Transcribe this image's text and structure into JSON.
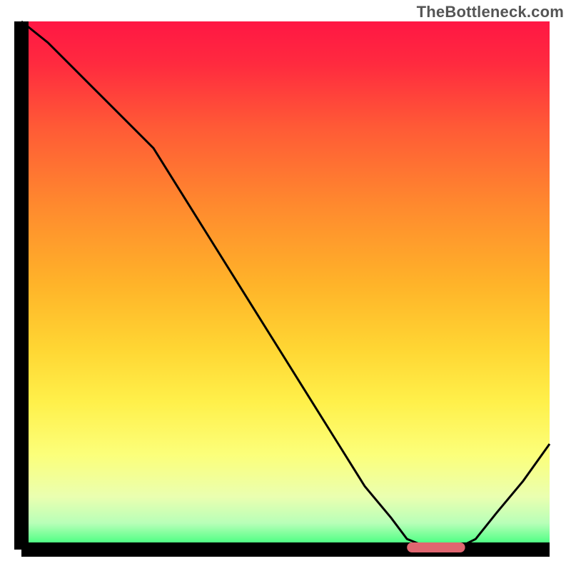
{
  "watermark": "TheBottleneck.com",
  "chart_data": {
    "type": "line",
    "title": "",
    "xlabel": "",
    "ylabel": "",
    "xlim": [
      0,
      100
    ],
    "ylim": [
      0,
      100
    ],
    "grid": false,
    "series": [
      {
        "name": "bottleneck-curve",
        "x": [
          0,
          5,
          10,
          15,
          20,
          25,
          30,
          35,
          40,
          45,
          50,
          55,
          60,
          65,
          70,
          73,
          78,
          82,
          86,
          90,
          95,
          100
        ],
        "values": [
          100,
          96,
          91,
          86,
          81,
          76,
          68,
          60,
          52,
          44,
          36,
          28,
          20,
          12,
          6,
          2,
          0,
          0,
          2,
          7,
          13,
          20
        ]
      }
    ],
    "marker": {
      "name": "target-range",
      "x_start": 73,
      "x_end": 84,
      "y": 0
    },
    "background_gradient_stops": [
      {
        "offset": 0.0,
        "color": "#ff1744"
      },
      {
        "offset": 0.08,
        "color": "#ff2a3f"
      },
      {
        "offset": 0.2,
        "color": "#ff5a36"
      },
      {
        "offset": 0.35,
        "color": "#ff8a2e"
      },
      {
        "offset": 0.5,
        "color": "#ffb429"
      },
      {
        "offset": 0.62,
        "color": "#ffd633"
      },
      {
        "offset": 0.72,
        "color": "#fff04a"
      },
      {
        "offset": 0.82,
        "color": "#fcff7a"
      },
      {
        "offset": 0.9,
        "color": "#eaffb0"
      },
      {
        "offset": 0.95,
        "color": "#b8ffb8"
      },
      {
        "offset": 1.0,
        "color": "#2bff72"
      }
    ],
    "axis_color": "#000000",
    "line_color": "#000000",
    "marker_color": "#e06670"
  }
}
